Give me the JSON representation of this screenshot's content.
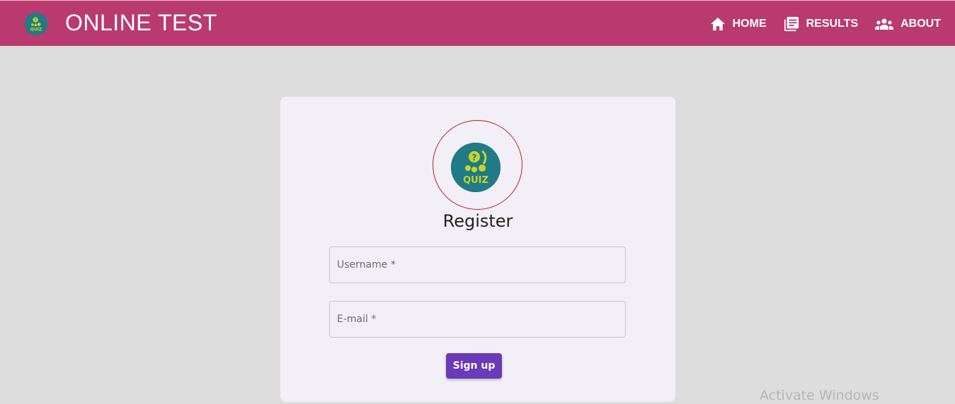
{
  "header": {
    "title": "ONLINE TEST",
    "logo_text": "QUIZ",
    "nav": [
      {
        "label": "HOME",
        "icon": "home-icon"
      },
      {
        "label": "RESULTS",
        "icon": "results-icon"
      },
      {
        "label": "ABOUT",
        "icon": "people-icon"
      }
    ]
  },
  "form": {
    "logo_text": "QUIZ",
    "title": "Register",
    "username": {
      "placeholder": "Username *",
      "value": ""
    },
    "email": {
      "placeholder": "E-mail *",
      "value": ""
    },
    "submit_label": "Sign up"
  },
  "watermark": "Activate Windows",
  "colors": {
    "header_bg": "#b83a6e",
    "page_bg": "#dddddd",
    "card_bg": "#f2eff6",
    "button_bg": "#6a3ab8",
    "logo_teal": "#1f7b86",
    "logo_yellow": "#c9d32a",
    "ring_red": "#c01c28"
  }
}
